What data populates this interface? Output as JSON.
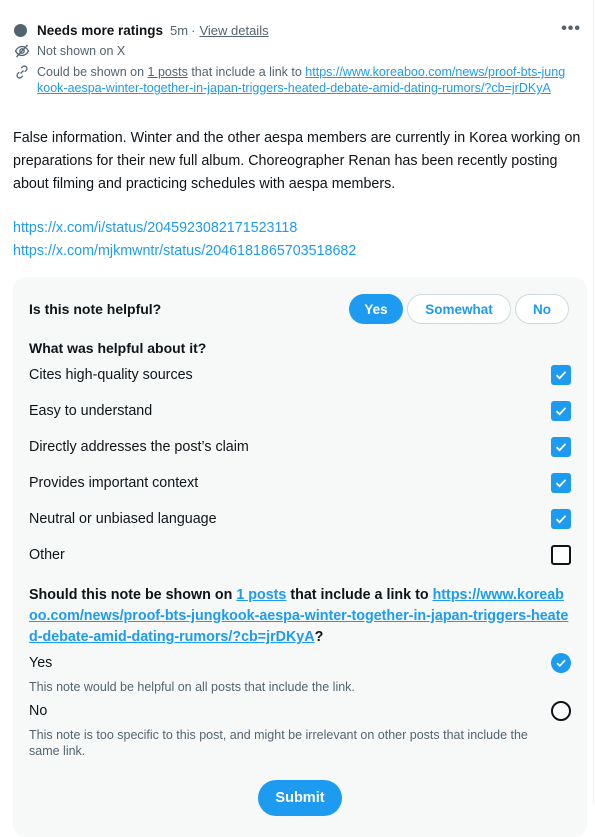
{
  "header": {
    "status_title": "Needs more ratings",
    "time_ago": "5m",
    "separator": "·",
    "view_details": "View details"
  },
  "info": {
    "not_shown": "Not shown on X",
    "could_be_shown_prefix": "Could be shown on",
    "posts_link": "1 posts",
    "could_be_shown_middle": "that include a link to",
    "link_url": "https://www.koreaboo.com/news/proof-bts-jungkook-aespa-winter-together-in-japan-triggers-heated-debate-amid-dating-rumors/?cb=jrDKyA"
  },
  "note": {
    "text": "False information. Winter and the other aespa members are currently in Korea working on preparations for their new full album. Choreographer Renan has been recently posting about filming and practicing schedules with aespa members.",
    "links": [
      "https://x.com/i/status/2045923082171523118",
      "https://x.com/mjkmwntr/status/2046181865703518682"
    ]
  },
  "rating": {
    "question": "Is this note helpful?",
    "options": [
      "Yes",
      "Somewhat",
      "No"
    ],
    "selected": "Yes",
    "helpful_question": "What was helpful about it?",
    "reasons": [
      {
        "label": "Cites high-quality sources",
        "checked": true
      },
      {
        "label": "Easy to understand",
        "checked": true
      },
      {
        "label": "Directly addresses the post’s claim",
        "checked": true
      },
      {
        "label": "Provides important context",
        "checked": true
      },
      {
        "label": "Neutral or unbiased language",
        "checked": true
      },
      {
        "label": "Other",
        "checked": false
      }
    ],
    "show_question_prefix": "Should this note be shown on",
    "show_question_posts": "1 posts",
    "show_question_middle": "that include a link to",
    "show_question_url": "https://www.koreaboo.com/news/proof-bts-jungkook-aespa-winter-together-in-japan-triggers-heated-debate-amid-dating-rumors/?cb=jrDKyA",
    "show_question_suffix": "?",
    "show_options": [
      {
        "label": "Yes",
        "desc": "This note would be helpful on all posts that include the link.",
        "selected": true
      },
      {
        "label": "No",
        "desc": "This note is too specific to this post, and might be irrelevant on other posts that include the same link.",
        "selected": false
      }
    ],
    "submit": "Submit"
  },
  "colors": {
    "accent": "#1d9bf0",
    "text": "#0f1419",
    "muted": "#536471",
    "panel": "#f7f9f9"
  }
}
